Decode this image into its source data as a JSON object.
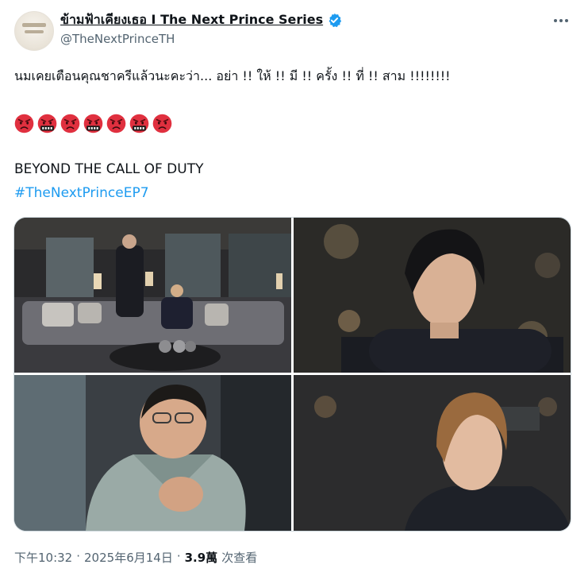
{
  "author": {
    "display_name": "ข้ามฟ้าเคียงเธอ I The Next Prince Series",
    "handle": "@TheNextPrinceTH",
    "avatar_icon": "series-logo-avatar"
  },
  "tweet": {
    "text": "นมเคยเตือนคุณชาครีแล้วนะคะว่า... อย่า !! ให้ !! มี !! ครั้ง !! ที่ !! สาม !!!!!!!!",
    "emojis": [
      "pouting-face",
      "face-with-symbols-on-mouth",
      "pouting-face",
      "face-with-symbols-on-mouth",
      "pouting-face",
      "face-with-symbols-on-mouth",
      "pouting-face"
    ],
    "line3": "BEYOND THE CALL OF DUTY",
    "hashtag": "#TheNextPrinceEP7"
  },
  "media": {
    "images": [
      {
        "name": "photo-living-room-scene"
      },
      {
        "name": "photo-dark-hair-closeup"
      },
      {
        "name": "photo-nanny-character"
      },
      {
        "name": "photo-blonde-closeup"
      }
    ]
  },
  "footer": {
    "time": "下午10:32",
    "sep1": "·",
    "date": "2025年6月14日",
    "sep2": "·",
    "views_count": "3.9萬",
    "views_label": "次查看"
  },
  "colors": {
    "text": "#0f1419",
    "secondary": "#536471",
    "link": "#1d9bf0",
    "verified": "#1d9bf0",
    "border": "#cfd9de",
    "emoji_red": "#e0303f"
  }
}
